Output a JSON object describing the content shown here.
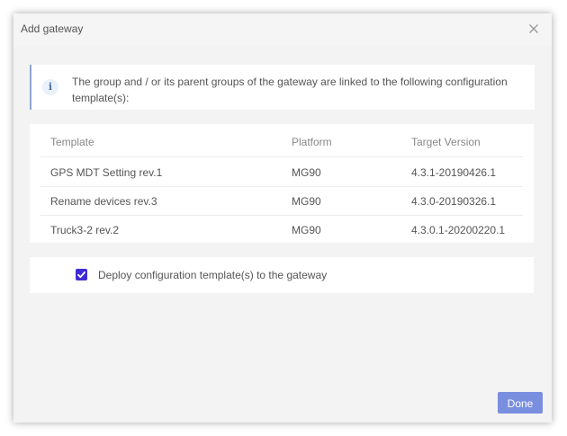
{
  "dialog": {
    "title": "Add gateway",
    "close_icon": "close-icon"
  },
  "info": {
    "icon": "info-icon",
    "icon_glyph": "i",
    "text": "The group and / or its parent groups of the gateway are linked to the following configuration template(s):"
  },
  "table": {
    "headers": [
      "Template",
      "Platform",
      "Target Version"
    ],
    "rows": [
      {
        "template": "GPS MDT Setting rev.1",
        "platform": "MG90",
        "version": "4.3.1-20190426.1"
      },
      {
        "template": "Rename devices rev.3",
        "platform": "MG90",
        "version": "4.3.0-20190326.1"
      },
      {
        "template": "Truck3-2 rev.2",
        "platform": "MG90",
        "version": "4.3.0.1-20200220.1"
      }
    ]
  },
  "deploy": {
    "checked": true,
    "label": "Deploy configuration template(s) to the gateway"
  },
  "footer": {
    "done_label": "Done"
  },
  "colors": {
    "accent": "#7a8ee0",
    "checkbox": "#3f2bd6",
    "info_border": "#8ea6d1"
  }
}
